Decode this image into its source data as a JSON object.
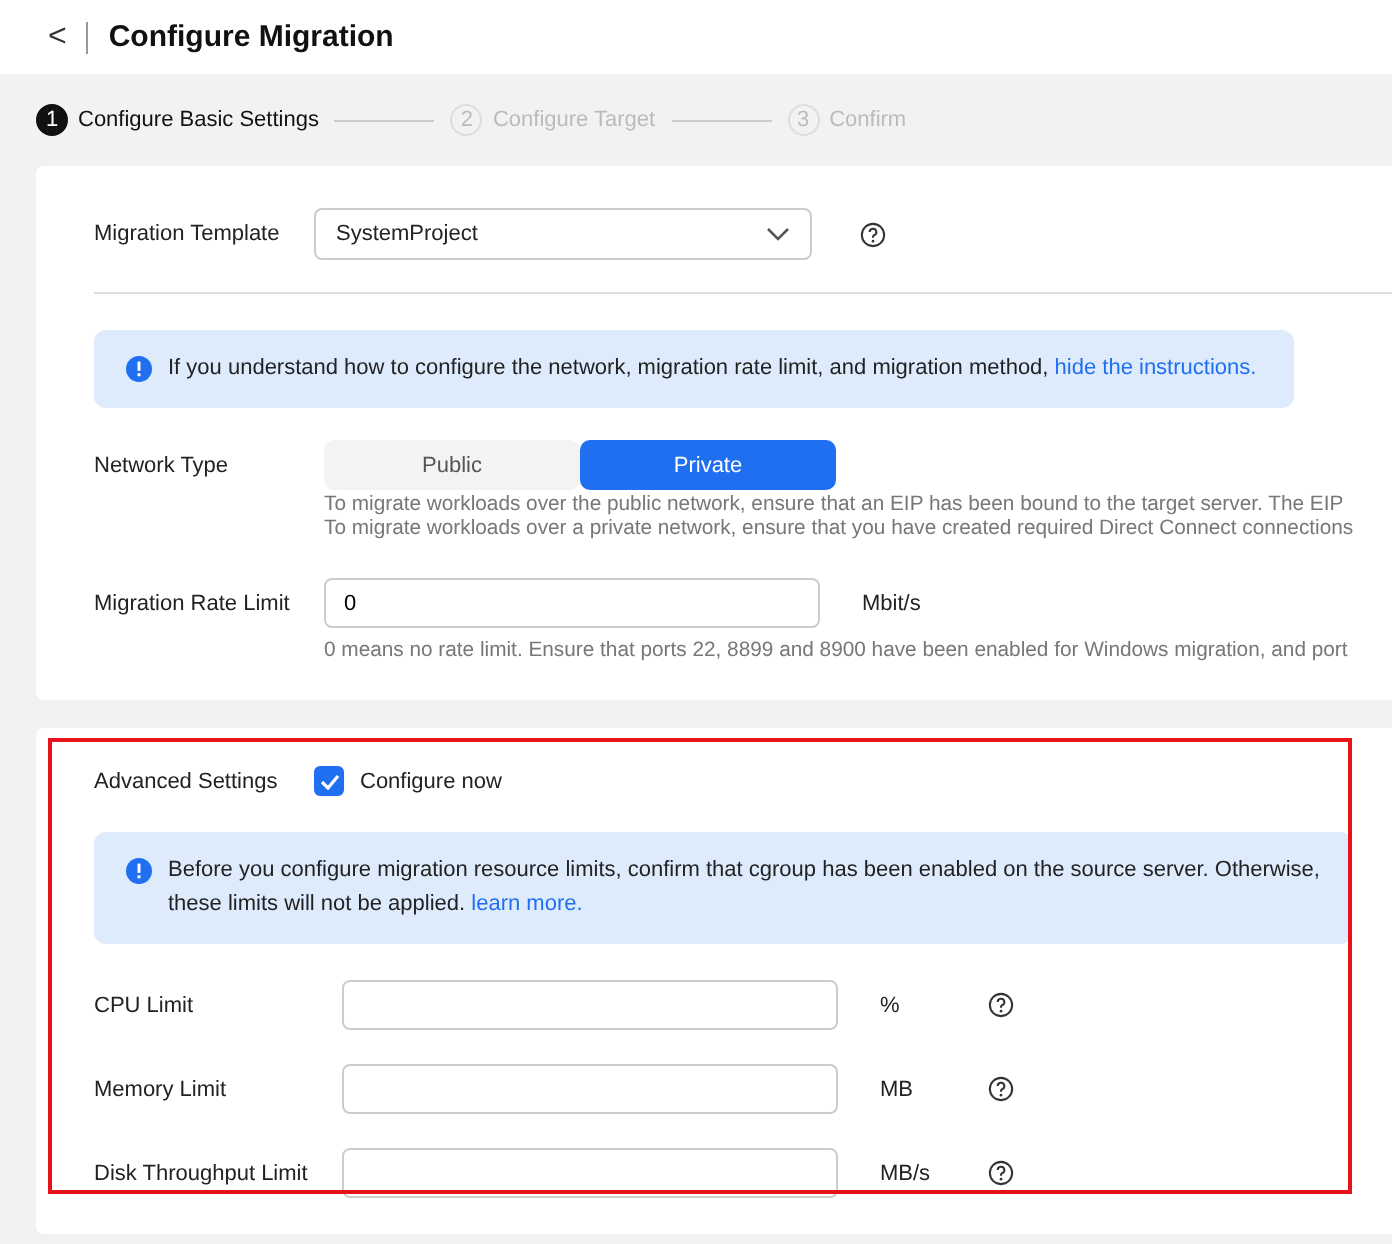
{
  "header": {
    "back": "<",
    "title": "Configure Migration"
  },
  "steps": [
    {
      "number": "1",
      "label": "Configure Basic Settings",
      "selected": true
    },
    {
      "number": "2",
      "label": "Configure Target",
      "selected": false
    },
    {
      "number": "3",
      "label": "Confirm",
      "selected": false
    }
  ],
  "basic": {
    "template": {
      "label": "Migration Template",
      "value": "SystemProject"
    },
    "notice": {
      "text": "If you understand how to configure the network, migration rate limit, and migration method,",
      "link": "hide the instructions."
    },
    "network": {
      "label": "Network Type",
      "options": [
        {
          "label": "Public",
          "selected": false
        },
        {
          "label": "Private",
          "selected": true
        }
      ],
      "hints": [
        "To migrate workloads over the public network, ensure that an EIP has been bound to the target server. The EIP",
        "To migrate workloads over a private network, ensure that you have created required Direct Connect connections"
      ]
    },
    "rate": {
      "label": "Migration Rate Limit",
      "value": "0",
      "unit": "Mbit/s",
      "hint": "0 means no rate limit. Ensure that ports 22, 8899 and 8900 have been enabled for Windows migration, and port"
    }
  },
  "advanced": {
    "label": "Advanced Settings",
    "configure": {
      "label": "Configure now",
      "checked": true
    },
    "notice": {
      "text": "Before you configure migration resource limits, confirm that cgroup has been enabled on the source server. Otherwise, these limits will not be applied.",
      "link": "learn more."
    },
    "limits": [
      {
        "label": "CPU Limit",
        "unit": "%"
      },
      {
        "label": "Memory Limit",
        "unit": "MB"
      },
      {
        "label": "Disk Throughput Limit",
        "unit": "MB/s"
      }
    ]
  }
}
